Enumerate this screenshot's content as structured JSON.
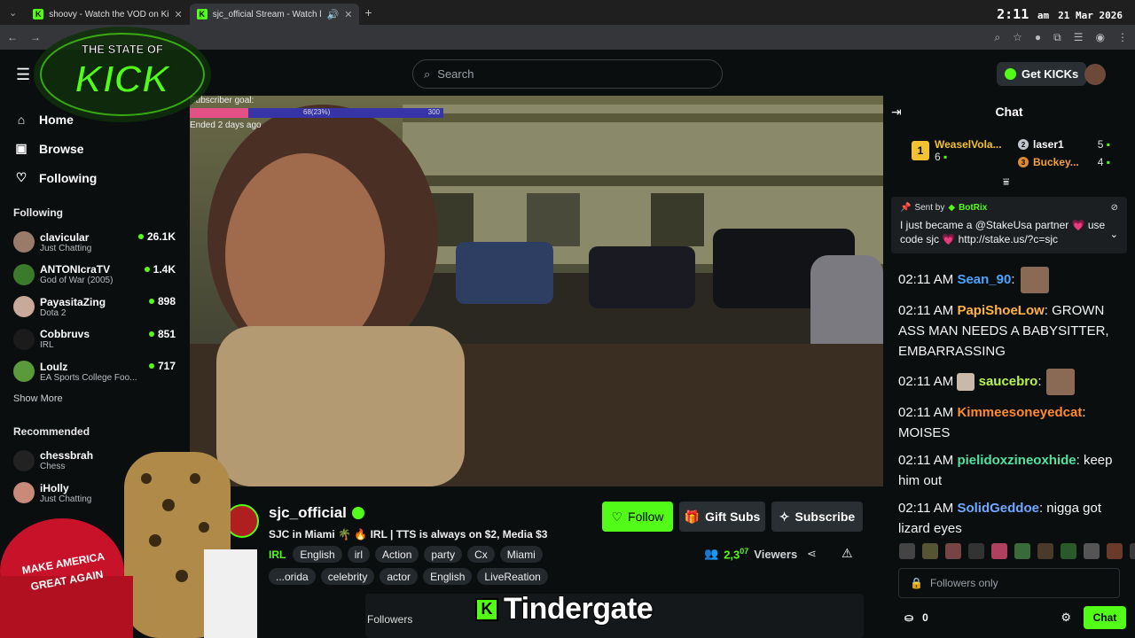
{
  "browser": {
    "tabs": [
      {
        "label": "shoovy - Watch the VOD on Ki"
      },
      {
        "label": "sjc_official Stream - Watch l"
      }
    ],
    "clock": {
      "time": "2:11",
      "ampm": "am",
      "date": "21 Mar 2026"
    }
  },
  "overlay_logo": {
    "line1": "THE STATE OF",
    "line2": "KICK"
  },
  "header": {
    "search_placeholder": "Search",
    "get_kicks_label": "Get KICKs"
  },
  "sidebar": {
    "nav": [
      {
        "label": "Home"
      },
      {
        "label": "Browse"
      },
      {
        "label": "Following"
      }
    ],
    "following_title": "Following",
    "following": [
      {
        "name": "clavicular",
        "category": "Just Chatting",
        "viewers": "26.1K"
      },
      {
        "name": "ANTONIcraTV",
        "category": "God of War (2005)",
        "viewers": "1.4K"
      },
      {
        "name": "PayasitaZing",
        "category": "Dota 2",
        "viewers": "898"
      },
      {
        "name": "Cobbruvs",
        "category": "IRL",
        "viewers": "851"
      },
      {
        "name": "Loulz",
        "category": "EA Sports College Foo...",
        "viewers": "717"
      }
    ],
    "show_more": "Show More",
    "recommended_title": "Recommended",
    "recommended": [
      {
        "name": "chessbrah",
        "category": "Chess"
      },
      {
        "name": "iHolly",
        "category": "Just Chatting"
      }
    ]
  },
  "video": {
    "subscriber_goal_label": "Subscriber goal:",
    "goal_progress_text": "68(23%)",
    "goal_max": "300",
    "goal_fraction": 0.23,
    "ended_text": "Ended 2 days ago"
  },
  "streamer": {
    "name": "sjc_official",
    "title": "SJC in Miami 🌴 🔥 IRL | TTS is always on $2, Media $3",
    "category": "IRL",
    "tags_row1": [
      "English",
      "irl",
      "Action",
      "party",
      "Cx",
      "Miami"
    ],
    "tags_row2": [
      "...orida",
      "celebrity",
      "actor",
      "English",
      "LiveReation"
    ],
    "follow_label": "Follow",
    "gift_label": "Gift Subs",
    "subscribe_label": "Subscribe",
    "viewers_num": "2,3",
    "viewers_sup": "07",
    "viewers_label": "Viewers",
    "followers_label": "Followers",
    "overlay_caption": "Tindergate"
  },
  "chat": {
    "title": "Chat",
    "top_gifters": [
      {
        "rank": "1",
        "name": "WeaselVola...",
        "count": "6"
      },
      {
        "rank": "2",
        "name": "laser1",
        "count": "5"
      },
      {
        "rank": "3",
        "name": "Buckey...",
        "count": "4"
      }
    ],
    "pinned": {
      "sent_by_prefix": "Sent by",
      "sender": "BotRix",
      "message": "I just became a @StakeUsa partner 💗 use code sjc 💗 http://stake.us/?c=sjc"
    },
    "messages": [
      {
        "time": "02:11 AM",
        "user": "Sean_90",
        "text": "",
        "color": "#4aa3ff"
      },
      {
        "time": "02:11 AM",
        "user": "PapiShoeLow",
        "text": " GROWN ASS MAN NEEDS A BABYSITTER, EMBARRASSING",
        "color": "#ffb347"
      },
      {
        "time": "02:11 AM",
        "user": "saucebro",
        "text": "",
        "color": "#b7f34a"
      },
      {
        "time": "02:11 AM",
        "user": "Kimmeesoneyedcat",
        "text": " MOISES",
        "color": "#ff8a30"
      },
      {
        "time": "02:11 AM",
        "user": "pielidoxzineoxhide",
        "text": " keep him out",
        "color": "#53e0a0"
      },
      {
        "time": "02:11 AM",
        "user": "SolidGeddoe",
        "text": " nigga got lizard eyes",
        "color": "#6ea8ff"
      }
    ],
    "followers_only": "Followers only",
    "points": "0",
    "send_label": "Chat"
  }
}
